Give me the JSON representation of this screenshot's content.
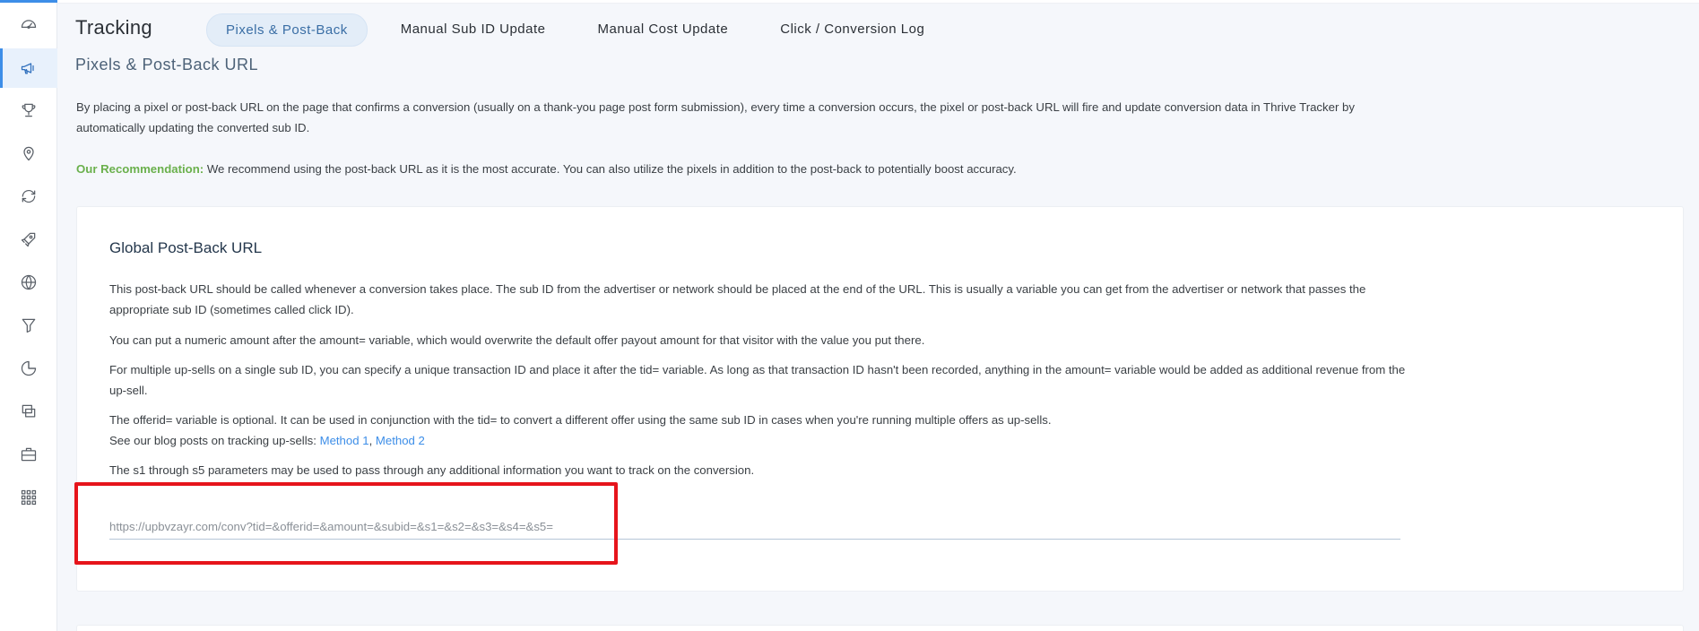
{
  "sidebar": {
    "items": [
      {
        "icon": "dashboard-gauge-icon",
        "label": "Dashboard",
        "active": false
      },
      {
        "icon": "megaphone-icon",
        "label": "Campaigns",
        "active": true
      },
      {
        "icon": "trophy-icon",
        "label": "Offers",
        "active": false
      },
      {
        "icon": "map-pin-icon",
        "label": "Landers",
        "active": false
      },
      {
        "icon": "refresh-icon",
        "label": "Rotators",
        "active": false
      },
      {
        "icon": "rocket-icon",
        "label": "Traffic Sources",
        "active": false
      },
      {
        "icon": "globe-icon",
        "label": "Networks",
        "active": false
      },
      {
        "icon": "funnel-icon",
        "label": "Funnels",
        "active": false
      },
      {
        "icon": "pie-chart-icon",
        "label": "Reports",
        "active": false
      },
      {
        "icon": "copy-windows-icon",
        "label": "Bulk",
        "active": false
      },
      {
        "icon": "briefcase-icon",
        "label": "Tools",
        "active": false
      },
      {
        "icon": "grid-apps-icon",
        "label": "Apps",
        "active": false
      }
    ]
  },
  "header": {
    "title": "Tracking",
    "tabs": [
      {
        "label": "Pixels & Post-Back",
        "active": true
      },
      {
        "label": "Manual Sub ID Update",
        "active": false
      },
      {
        "label": "Manual Cost Update",
        "active": false
      },
      {
        "label": "Click / Conversion Log",
        "active": false
      }
    ]
  },
  "section": {
    "heading": "Pixels & Post-Back URL",
    "intro": "By placing a pixel or post-back URL on the page that confirms a conversion (usually on a thank-you page post form submission), every time a conversion occurs, the pixel or post-back URL will fire and update conversion data in Thrive Tracker by automatically updating the converted sub ID.",
    "recommendation_label": "Our Recommendation:",
    "recommendation_text": " We recommend using the post-back URL as it is the most accurate. You can also utilize the pixels in addition to the post-back to potentially boost accuracy."
  },
  "card": {
    "title": "Global Post-Back URL",
    "para1": "This post-back URL should be called whenever a conversion takes place. The sub ID from the advertiser or network should be placed at the end of the URL. This is usually a variable you can get from the advertiser or network that passes the appropriate sub ID (sometimes called click ID).",
    "para2": "You can put a numeric amount after the amount= variable, which would overwrite the default offer payout amount for that visitor with the value you put there.",
    "para3": "For multiple up-sells on a single sub ID, you can specify a unique transaction ID and place it after the tid= variable. As long as that transaction ID hasn't been recorded, anything in the amount= variable would be added as additional revenue from the up-sell.",
    "para4": "The offerid= variable is optional. It can be used in conjunction with the tid= to convert a different offer using the same sub ID in cases when you're running multiple offers as up-sells.",
    "para5_prefix": "See our blog posts on tracking up-sells: ",
    "method1": "Method 1",
    "separator": ", ",
    "method2": "Method 2",
    "para6": "The s1 through s5 parameters may be used to pass through any additional information you want to track on the conversion.",
    "postback_url": "https://upbvzayr.com/conv?tid=&offerid=&amount=&subid=&s1=&s2=&s3=&s4=&s5="
  },
  "colors": {
    "accent": "#3d8ee8",
    "recommendation": "#6ab04c",
    "highlight": "#e6141b"
  }
}
